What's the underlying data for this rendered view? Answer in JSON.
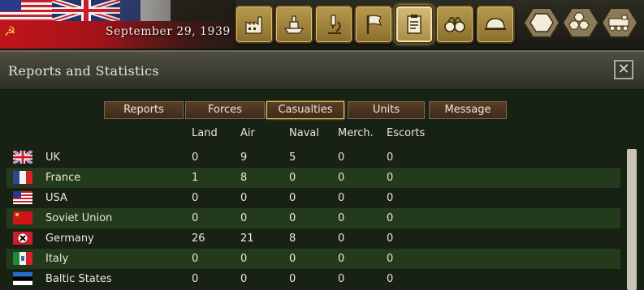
{
  "topbar": {
    "date": "September 29, 1939",
    "buttons": [
      {
        "name": "production-button",
        "icon": "factory-icon",
        "active": false
      },
      {
        "name": "diplomacy-button",
        "icon": "ship-icon",
        "active": false
      },
      {
        "name": "research-button",
        "icon": "microscope-icon",
        "active": false
      },
      {
        "name": "objectives-button",
        "icon": "flag-icon",
        "active": false
      },
      {
        "name": "reports-button",
        "icon": "clipboard-icon",
        "active": true
      },
      {
        "name": "intelligence-button",
        "icon": "binoculars-icon",
        "active": false
      },
      {
        "name": "units-button",
        "icon": "helmet-icon",
        "active": false
      }
    ],
    "hex_buttons": [
      {
        "name": "hex-toggle-button",
        "icon": "hexagon-icon"
      },
      {
        "name": "hex-grid-button",
        "icon": "hex-grid-icon"
      },
      {
        "name": "rail-button",
        "icon": "locomotive-icon"
      }
    ]
  },
  "panel": {
    "title": "Reports and Statistics",
    "close_label": "✕"
  },
  "tabs": [
    {
      "label": "Reports",
      "active": false
    },
    {
      "label": "Forces",
      "active": false
    },
    {
      "label": "Casualties",
      "active": true
    },
    {
      "label": "Units",
      "active": false
    },
    {
      "label": "Message",
      "active": false
    }
  ],
  "columns": [
    "Land",
    "Air",
    "Naval",
    "Merch.",
    "Escorts"
  ],
  "rows": [
    {
      "country": "UK",
      "flag": "uk-flag-icon",
      "land": "0",
      "air": "9",
      "naval": "5",
      "merch": "0",
      "escorts": "0"
    },
    {
      "country": "France",
      "flag": "france-flag-icon",
      "land": "1",
      "air": "8",
      "naval": "0",
      "merch": "0",
      "escorts": "0"
    },
    {
      "country": "USA",
      "flag": "usa-flag-icon",
      "land": "0",
      "air": "0",
      "naval": "0",
      "merch": "0",
      "escorts": "0"
    },
    {
      "country": "Soviet Union",
      "flag": "soviet-flag-icon",
      "land": "0",
      "air": "0",
      "naval": "0",
      "merch": "0",
      "escorts": "0"
    },
    {
      "country": "Germany",
      "flag": "germany-flag-icon",
      "land": "26",
      "air": "21",
      "naval": "8",
      "merch": "0",
      "escorts": "0"
    },
    {
      "country": "Italy",
      "flag": "italy-flag-icon",
      "land": "0",
      "air": "0",
      "naval": "0",
      "merch": "0",
      "escorts": "0"
    },
    {
      "country": "Baltic States",
      "flag": "baltic-flag-icon",
      "land": "0",
      "air": "0",
      "naval": "0",
      "merch": "0",
      "escorts": "0"
    }
  ],
  "colors": {
    "tab_active_border": "#f0c660",
    "row_even": "#243a1c",
    "panel_bg": "#172114"
  }
}
